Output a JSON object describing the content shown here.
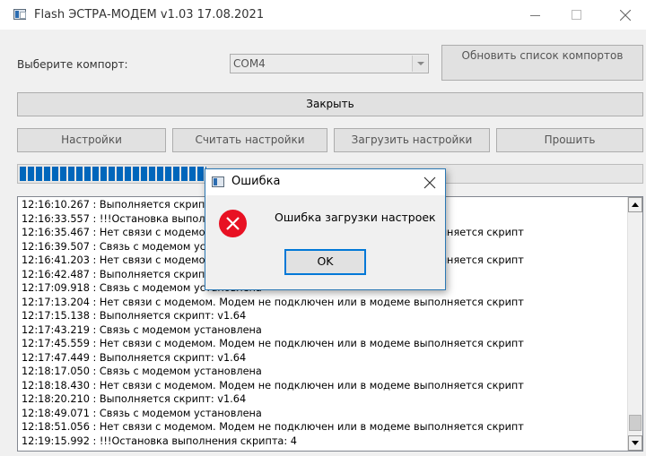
{
  "window": {
    "title": "Flash ЭСТРА-МОДЕМ v1.03 17.08.2021",
    "icons": {
      "app": "app-window-icon",
      "minimize": "minimize-icon",
      "maximize": "maximize-icon",
      "close": "close-icon"
    }
  },
  "port": {
    "label": "Выберите компорт:",
    "selected": "COM4",
    "refresh_label": "Обновить список компортов"
  },
  "buttons": {
    "close": "Закрыть",
    "settings": "Настройки",
    "read_settings": "Считать настройки",
    "load_settings": "Загрузить настройки",
    "flash": "Прошить"
  },
  "progress": {
    "fraction": 0.3,
    "color": "#0066bb"
  },
  "log": {
    "lines": [
      "12:16:10.267 : Выполняется скрипт: v1.64",
      "12:16:33.557 : !!!Остановка выполнения скрипта: 4",
      "12:16:35.467 : Нет связи с модемом. Модем не подключен или в модеме выполняется скрипт",
      "12:16:39.507 : Связь с модемом установлена",
      "12:16:41.203 : Нет связи с модемом. Модем не подключен или в модеме выполняется скрипт",
      "12:16:42.487 : Выполняется скрипт: v1.64",
      "12:17:09.918 : Связь с модемом установлена",
      "12:17:13.204 : Нет связи с модемом. Модем не подключен или в модеме выполняется скрипт",
      "12:17:15.138 : Выполняется скрипт: v1.64",
      "12:17:43.219 : Связь с модемом установлена",
      "12:17:45.559 : Нет связи с модемом. Модем не подключен или в модеме выполняется скрипт",
      "12:17:47.449 : Выполняется скрипт: v1.64",
      "12:18:17.050 : Связь с модемом установлена",
      "12:18:18.430 : Нет связи с модемом. Модем не подключен или в модеме выполняется скрипт",
      "12:18:20.210 : Выполняется скрипт: v1.64",
      "12:18:49.071 : Связь с модемом установлена",
      "12:18:51.056 : Нет связи с модемом. Модем не подключен или в модеме выполняется скрипт",
      "12:19:15.992 : !!!Остановка выполнения скрипта: 4"
    ]
  },
  "dialog": {
    "title": "Ошибка",
    "message": "Ошибка загрузки настроек",
    "ok_label": "OK",
    "icon": "error-icon",
    "accent": "#e81123"
  }
}
